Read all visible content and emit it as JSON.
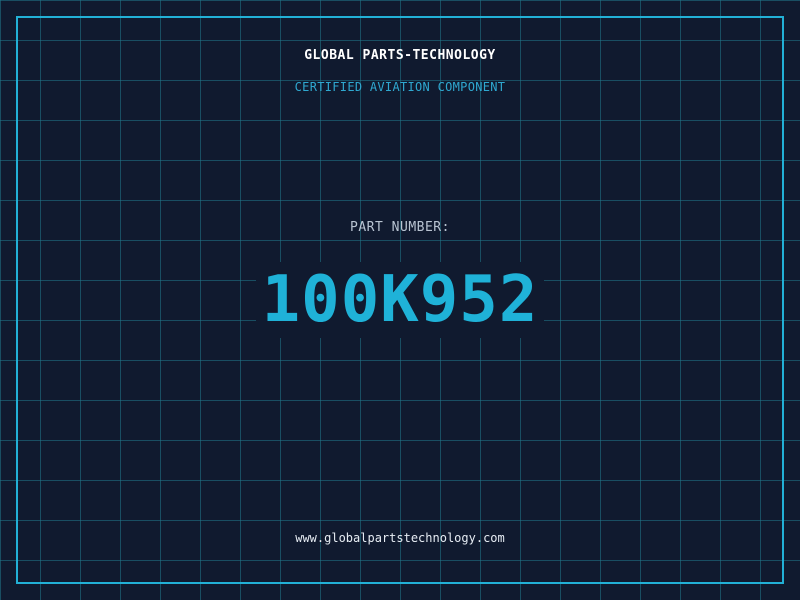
{
  "header": {
    "company_name": "GLOBAL PARTS-TECHNOLOGY",
    "tagline": "CERTIFIED AVIATION COMPONENT"
  },
  "part": {
    "label": "PART NUMBER:",
    "number": "100K952"
  },
  "footer": {
    "website": "www.globalpartstechnology.com"
  },
  "colors": {
    "background": "#101a2f",
    "grid": "#21788c",
    "frame": "#22b0d6",
    "accent": "#1fb2d8",
    "tagline": "#2fa8d0",
    "label": "#b9c4d2",
    "text": "#ffffff"
  }
}
